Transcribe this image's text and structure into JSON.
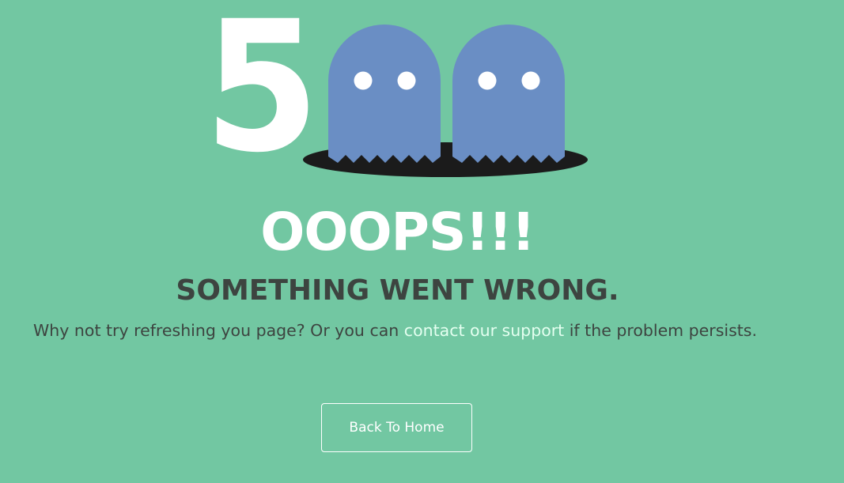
{
  "error_graphic": {
    "digit": "5",
    "ghost_color": "#6a8ec4",
    "hole_color": "#1b1b1b",
    "eye_color": "#ffffff"
  },
  "headline": "OOOPS!!!",
  "subheadline": "SOMETHING WENT WRONG.",
  "message": {
    "before_link": "Why not try refreshing you page? Or you can ",
    "link_text": "contact our support",
    "after_link": " if the problem persists."
  },
  "back_button": {
    "label": "Back To Home"
  },
  "colors": {
    "background": "#72c7a2",
    "headline": "#ffffff",
    "subheadline": "#3d4440",
    "body_text": "#3d4440",
    "link": "#e4fff0"
  }
}
